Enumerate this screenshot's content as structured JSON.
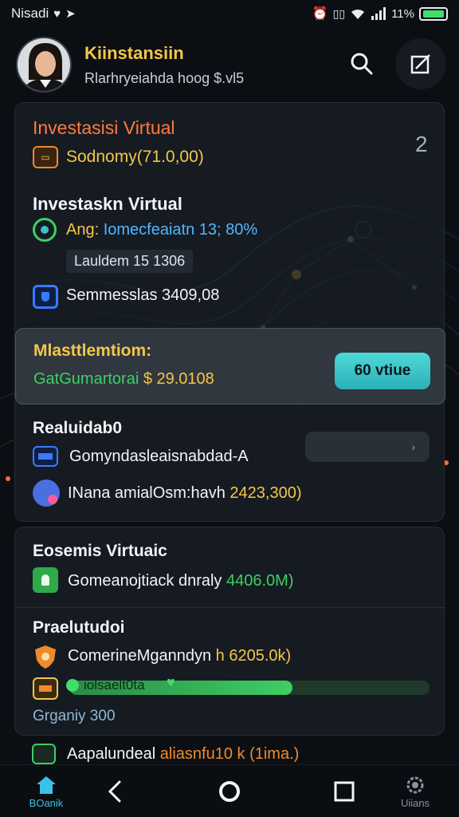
{
  "status": {
    "left_text": "Nisadi",
    "battery": "11%"
  },
  "header": {
    "name": "Kiinstansiin",
    "subtitle": "Rlarhryeiahda hoog $.vl5"
  },
  "card1": {
    "title": "Investasisi Virtual",
    "count": "2",
    "row1": "Sodnomy(71.0,00)",
    "section_title": "Investaskn Virtual",
    "row2_prefix": "Ang: ",
    "row2_text": "Iomecfeaiatn 13; 80%",
    "badge": "Lauldem 15 1306",
    "row3": "Semmesslas 3409,08",
    "highlight": {
      "title": "Mlasttlemtiom:",
      "text_green": "GatGumartorai ",
      "text_yellow": "$ 29.0108",
      "button": "60 vtiue"
    },
    "section2_title": "Realuidab0",
    "row4": "Gomyndasleaisnabdad-A",
    "row5_text": "INana amialOsm:havh ",
    "row5_value": "2423,300)"
  },
  "card2": {
    "title": "Eosemis Virtuaic",
    "row1_text": "Gomeanojtiack dnraly ",
    "row1_value": "4406.0M)",
    "section_title": "Praelutudoi",
    "row2_text": "ComerineMganndyn ",
    "row2_value": "h 6205.0k)",
    "progress": {
      "label": "iolsaelt0ta",
      "value": 0.62
    },
    "row3": "Grganiy 300"
  },
  "partial_row": {
    "text": "Aapalundeal ",
    "value": "aliasnfu10 k (1ima.)"
  },
  "nav": {
    "home_label": "BOanik",
    "right_label": "Uiians"
  },
  "colors": {
    "accent_gold": "#f4c64a",
    "accent_orange": "#ff7a3c",
    "accent_green": "#3ecf64",
    "accent_teal": "#39c1c8",
    "background": "#0b0f14"
  }
}
